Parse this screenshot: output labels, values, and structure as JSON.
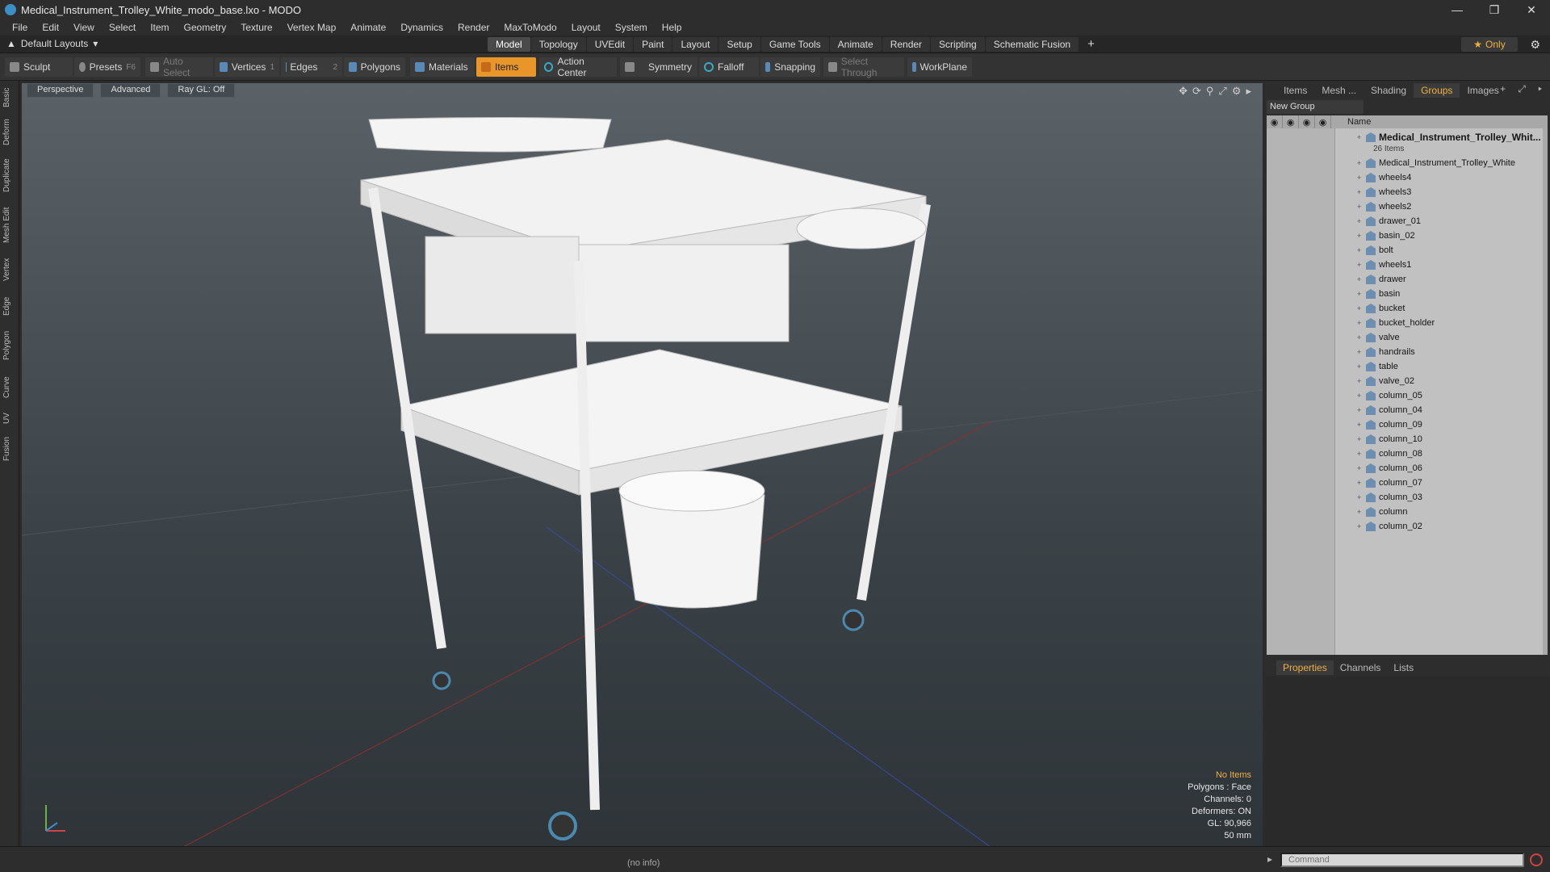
{
  "window": {
    "title": "Medical_Instrument_Trolley_White_modo_base.lxo - MODO"
  },
  "menu": [
    "File",
    "Edit",
    "View",
    "Select",
    "Item",
    "Geometry",
    "Texture",
    "Vertex Map",
    "Animate",
    "Dynamics",
    "Render",
    "MaxToModo",
    "Layout",
    "System",
    "Help"
  ],
  "layout": {
    "selector": "Default Layouts"
  },
  "tabs": [
    "Model",
    "Topology",
    "UVEdit",
    "Paint",
    "Layout",
    "Setup",
    "Game Tools",
    "Animate",
    "Render",
    "Scripting",
    "Schematic Fusion"
  ],
  "active_tab": "Model",
  "only_label": "Only",
  "toolbar": {
    "sculpt": "Sculpt",
    "presets": "Presets",
    "presets_key": "F6",
    "auto_select": "Auto Select",
    "vertices": "Vertices",
    "vertices_count": "1",
    "edges": "Edges",
    "edges_count": "2",
    "polygons": "Polygons",
    "materials": "Materials",
    "items": "Items",
    "action_center": "Action Center",
    "symmetry": "Symmetry",
    "falloff": "Falloff",
    "snapping": "Snapping",
    "select_through": "Select Through",
    "workplane": "WorkPlane"
  },
  "left_tabs": [
    "Basic",
    "Deform",
    "Duplicate",
    "Mesh Edit",
    "Vertex",
    "Edge",
    "Polygon",
    "Curve",
    "UV",
    "Fusion"
  ],
  "viewport": {
    "perspective": "Perspective",
    "advanced": "Advanced",
    "raygl": "Ray GL: Off",
    "hud": {
      "no_items": "No Items",
      "polygons": "Polygons : Face",
      "channels": "Channels: 0",
      "deformers": "Deformers: ON",
      "gl": "GL: 90,966",
      "focal": "50 mm"
    }
  },
  "right_tabs": [
    "Items",
    "Mesh ...",
    "Shading",
    "Groups",
    "Images"
  ],
  "active_right_tab": "Groups",
  "new_group": "New Group",
  "tree": {
    "col_name": "Name",
    "group": "Medical_Instrument_Trolley_Whit...",
    "group_sub": "26 Items",
    "items": [
      "Medical_Instrument_Trolley_White",
      "wheels4",
      "wheels3",
      "wheels2",
      "drawer_01",
      "basin_02",
      "bolt",
      "wheels1",
      "drawer",
      "basin",
      "bucket",
      "bucket_holder",
      "valve",
      "handrails",
      "table",
      "valve_02",
      "column_05",
      "column_04",
      "column_09",
      "column_10",
      "column_08",
      "column_06",
      "column_07",
      "column_03",
      "column",
      "column_02"
    ]
  },
  "prop_tabs": [
    "Properties",
    "Channels",
    "Lists"
  ],
  "status": {
    "info": "(no info)",
    "command_placeholder": "Command"
  }
}
